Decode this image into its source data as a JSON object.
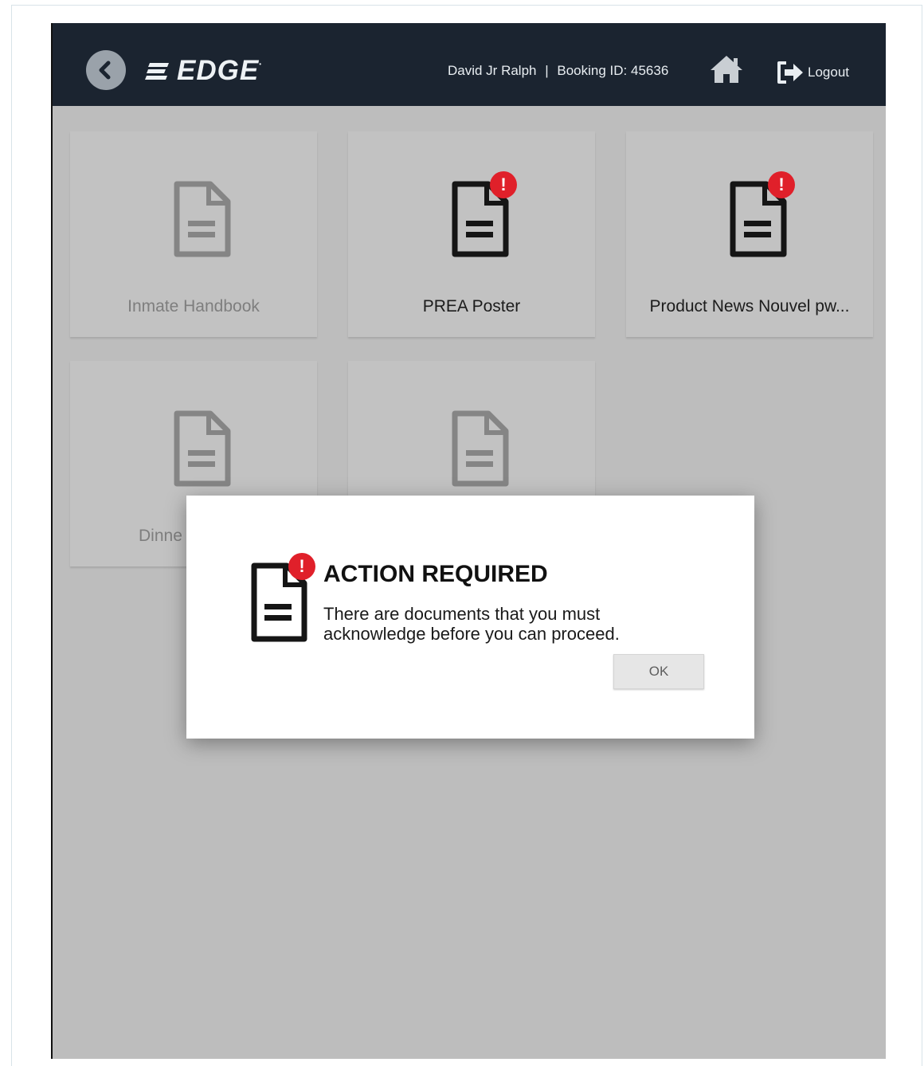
{
  "header": {
    "logo_text": "EDGE",
    "user_name": "David Jr Ralph",
    "separator": "|",
    "booking_label": "Booking ID:",
    "booking_id": "45636",
    "logout_label": "Logout",
    "icons": [
      "back-chevron-icon",
      "home-icon",
      "logout-icon"
    ],
    "background_color": "#1b2430"
  },
  "documents": [
    {
      "label": "Inmate Handbook",
      "requires_ack": false,
      "badge": ""
    },
    {
      "label": "PREA Poster",
      "requires_ack": true,
      "badge": "!"
    },
    {
      "label": "Product News Nouvel pw...",
      "requires_ack": true,
      "badge": "!"
    },
    {
      "label": "Dinne",
      "requires_ack": false,
      "badge": ""
    },
    {
      "label": "",
      "requires_ack": false,
      "badge": ""
    }
  ],
  "modal": {
    "title": "ACTION REQUIRED",
    "message": "There are documents that you must acknowledge before you can proceed.",
    "ok_label": "OK",
    "badge": "!",
    "icon": "document-alert-icon",
    "alert_color": "#e0202a"
  }
}
